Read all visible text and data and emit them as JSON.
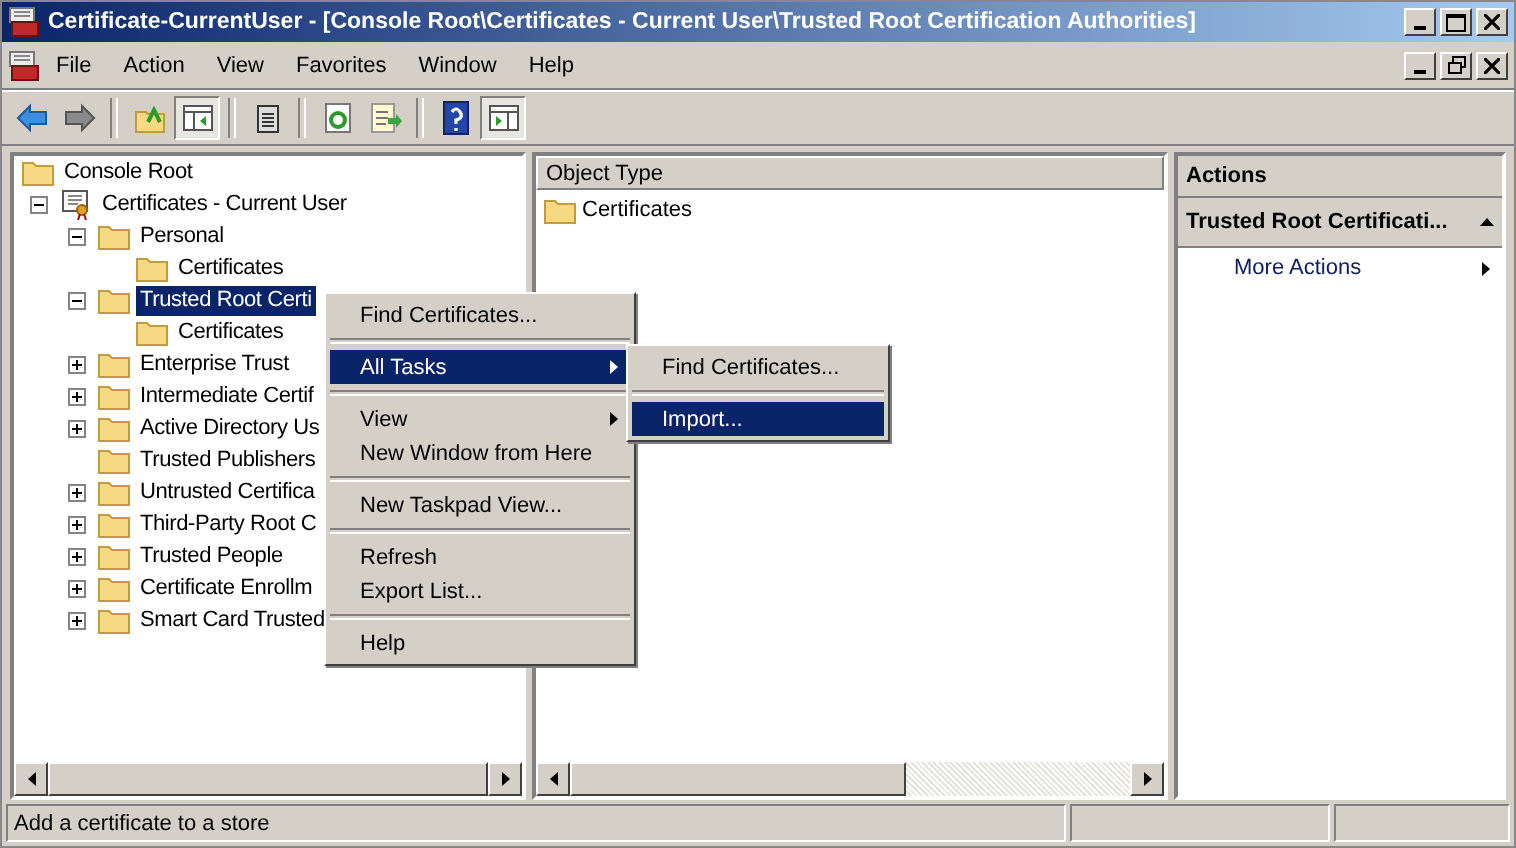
{
  "window": {
    "title": "Certificate-CurrentUser - [Console Root\\Certificates - Current User\\Trusted Root Certification Authorities]"
  },
  "menu_bar": [
    {
      "label": "File"
    },
    {
      "label": "Action"
    },
    {
      "label": "View"
    },
    {
      "label": "Favorites"
    },
    {
      "label": "Window"
    },
    {
      "label": "Help"
    }
  ],
  "toolbar": [
    {
      "kind": "back",
      "pressed": false
    },
    {
      "kind": "forward",
      "pressed": false
    },
    {
      "kind": "sep"
    },
    {
      "kind": "up",
      "pressed": false
    },
    {
      "kind": "tree",
      "pressed": true
    },
    {
      "kind": "sep"
    },
    {
      "kind": "clipboard",
      "pressed": false
    },
    {
      "kind": "sep"
    },
    {
      "kind": "refresh",
      "pressed": false
    },
    {
      "kind": "export",
      "pressed": false
    },
    {
      "kind": "sep"
    },
    {
      "kind": "help",
      "pressed": false
    },
    {
      "kind": "actionpane",
      "pressed": true
    }
  ],
  "tree": [
    {
      "label": "Console Root",
      "kind": "root",
      "selected": false,
      "children": [
        {
          "label": "Certificates - Current User",
          "kind": "store",
          "selected": false,
          "expanded": true,
          "children": [
            {
              "label": "Personal",
              "kind": "folder",
              "selected": false,
              "expanded": true,
              "children": [
                {
                  "label": "Certificates",
                  "kind": "folder",
                  "selected": false
                }
              ]
            },
            {
              "label": "Trusted Root Certi",
              "kind": "folder",
              "selected": true,
              "expanded": true,
              "children": [
                {
                  "label": "Certificates",
                  "kind": "folder",
                  "selected": false
                }
              ]
            },
            {
              "label": "Enterprise Trust",
              "kind": "folder",
              "selected": false,
              "expanded": false
            },
            {
              "label": "Intermediate Certif",
              "kind": "folder",
              "selected": false,
              "expanded": false
            },
            {
              "label": "Active Directory Us",
              "kind": "folder",
              "selected": false,
              "expanded": false
            },
            {
              "label": "Trusted Publishers",
              "kind": "folder",
              "selected": false
            },
            {
              "label": "Untrusted Certifica",
              "kind": "folder",
              "selected": false,
              "expanded": false
            },
            {
              "label": "Third-Party Root C",
              "kind": "folder",
              "selected": false,
              "expanded": false
            },
            {
              "label": "Trusted People",
              "kind": "folder",
              "selected": false,
              "expanded": false
            },
            {
              "label": "Certificate Enrollm",
              "kind": "folder",
              "selected": false,
              "expanded": false
            },
            {
              "label": "Smart Card Trusted",
              "kind": "folder",
              "selected": false,
              "expanded": false
            }
          ]
        }
      ]
    }
  ],
  "list": {
    "columns": [
      "Object Type"
    ],
    "rows": [
      {
        "label": "Certificates"
      }
    ]
  },
  "actions": {
    "title": "Actions",
    "section": {
      "label": "Trusted Root Certificati...",
      "expanded": true
    },
    "items": [
      {
        "label": "More Actions",
        "submenu": true
      }
    ]
  },
  "context_menu": [
    {
      "kind": "item",
      "label": "Find Certificates...",
      "selected": false,
      "submenu": false
    },
    {
      "kind": "separator"
    },
    {
      "kind": "item",
      "label": "All Tasks",
      "selected": true,
      "submenu": true
    },
    {
      "kind": "separator"
    },
    {
      "kind": "item",
      "label": "View",
      "selected": false,
      "submenu": true
    },
    {
      "kind": "item",
      "label": "New Window from Here",
      "selected": false,
      "submenu": false
    },
    {
      "kind": "separator"
    },
    {
      "kind": "item",
      "label": "New Taskpad View...",
      "selected": false,
      "submenu": false
    },
    {
      "kind": "separator"
    },
    {
      "kind": "item",
      "label": "Refresh",
      "selected": false,
      "submenu": false
    },
    {
      "kind": "item",
      "label": "Export List...",
      "selected": false,
      "submenu": false
    },
    {
      "kind": "separator"
    },
    {
      "kind": "item",
      "label": "Help",
      "selected": false,
      "submenu": false
    }
  ],
  "submenu": [
    {
      "kind": "item",
      "label": "Find Certificates...",
      "selected": false,
      "submenu": false
    },
    {
      "kind": "separator"
    },
    {
      "kind": "item",
      "label": "Import...",
      "selected": true,
      "submenu": false
    }
  ],
  "status_bar": {
    "text": "Add a certificate to a store"
  }
}
